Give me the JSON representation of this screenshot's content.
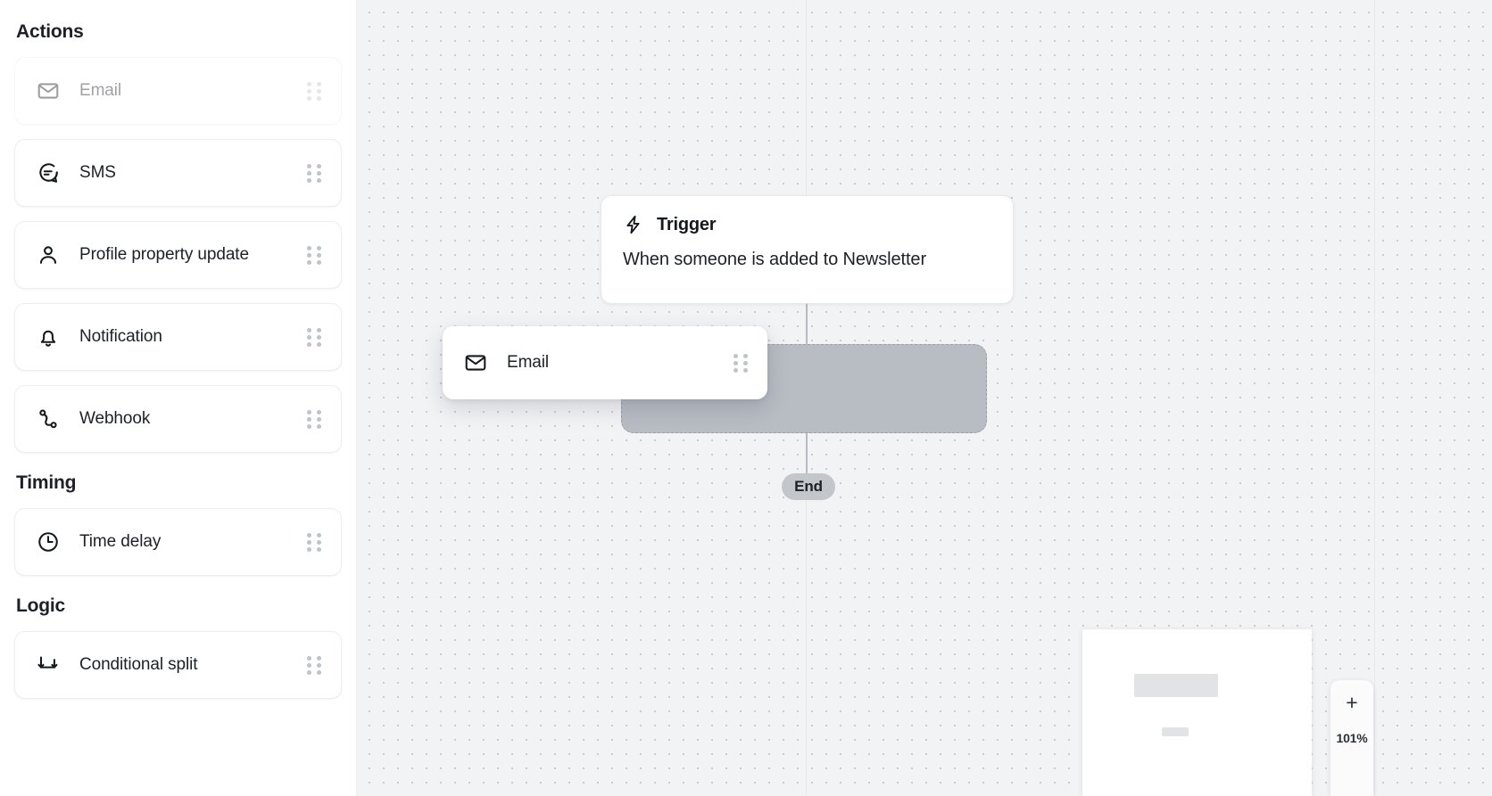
{
  "sidebar": {
    "sections": [
      {
        "id": "actions",
        "title": "Actions",
        "items": [
          {
            "label": "Email",
            "icon": "envelope-icon",
            "state": "dragging"
          },
          {
            "label": "SMS",
            "icon": "chat-bubble-icon",
            "state": "normal"
          },
          {
            "label": "Profile property update",
            "icon": "person-icon",
            "state": "normal"
          },
          {
            "label": "Notification",
            "icon": "bell-icon",
            "state": "normal"
          },
          {
            "label": "Webhook",
            "icon": "webhook-icon",
            "state": "normal"
          }
        ]
      },
      {
        "id": "timing",
        "title": "Timing",
        "items": [
          {
            "label": "Time delay",
            "icon": "clock-icon",
            "state": "normal"
          }
        ]
      },
      {
        "id": "logic",
        "title": "Logic",
        "items": [
          {
            "label": "Conditional split",
            "icon": "split-arrows-icon",
            "state": "normal"
          }
        ]
      }
    ],
    "drag_handle_icon": "drag-handle-icon"
  },
  "canvas": {
    "trigger_node": {
      "icon": "lightning-bolt-icon",
      "title": "Trigger",
      "description": "When someone is added to Newsletter"
    },
    "drop_zone": {
      "label": ""
    },
    "end_node": {
      "label": "End"
    },
    "drag_ghost": {
      "label": "Email",
      "icon": "envelope-icon"
    }
  },
  "zoom_control": {
    "plus_label": "+",
    "level": "101%"
  },
  "colors": {
    "canvas_background": "#f2f3f5",
    "canvas_dot": "#c9ccd1",
    "card_border": "#eceef0",
    "drop_zone_fill": "#b8bcc3",
    "drop_zone_border": "#9aa0a8",
    "end_pill_fill": "#c3c7cc",
    "text_primary": "#1d2026",
    "handle_dot": "#bfc4cb"
  }
}
